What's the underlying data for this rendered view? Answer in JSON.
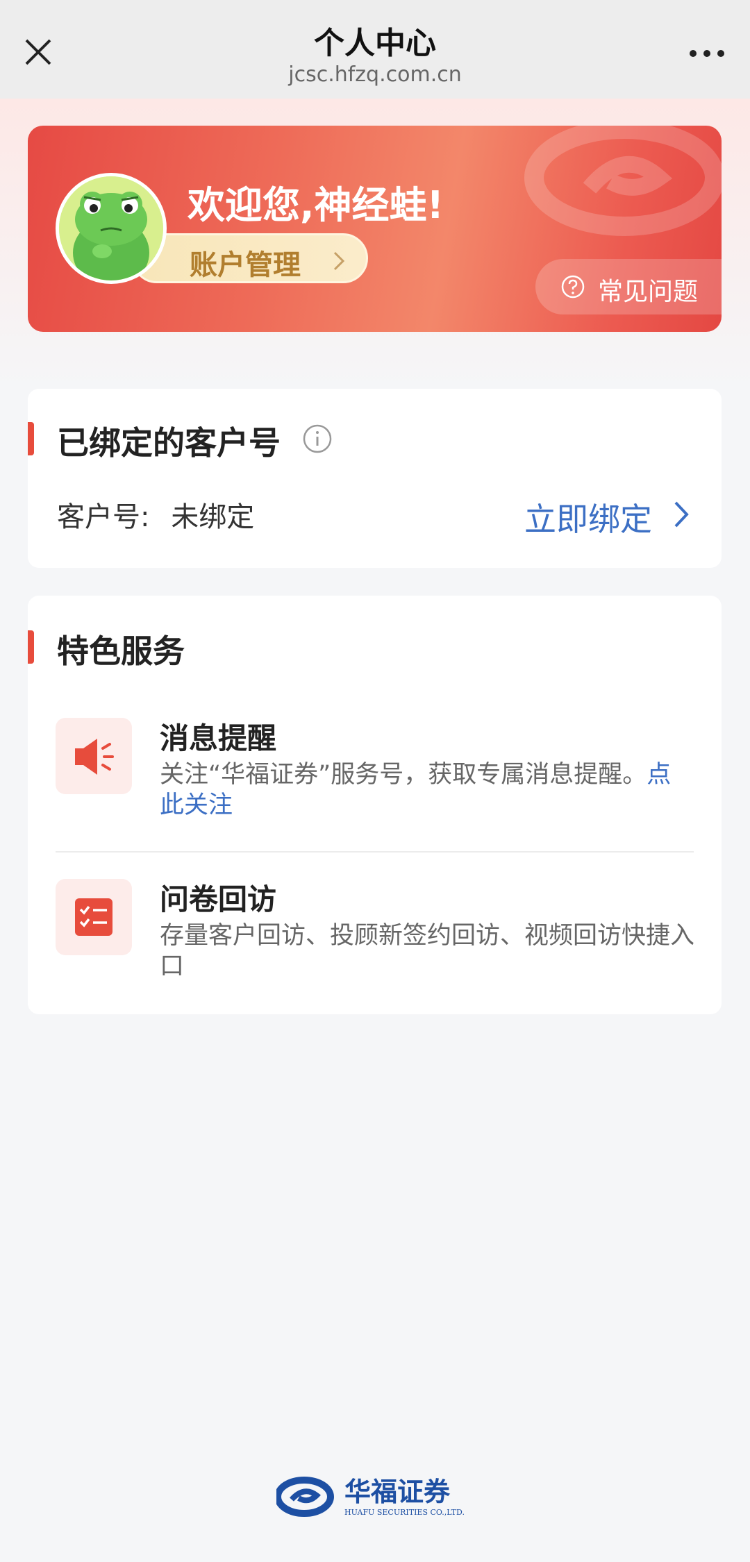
{
  "topbar": {
    "title": "个人中心",
    "url": "jcsc.hfzq.com.cn",
    "close_icon": "close-icon",
    "more_icon": "more-icon"
  },
  "banner": {
    "welcome": "欢迎您,神经蛙!",
    "account_button": "账户管理",
    "faq_button": "常见问题",
    "colors": {
      "start": "#e64a44",
      "mid": "#f3876a",
      "end": "#e44843"
    }
  },
  "bound_account": {
    "title": "已绑定的客户号",
    "customer_label": "客户号:",
    "customer_value": "未绑定",
    "bind_link": "立即绑定"
  },
  "services": {
    "title": "特色服务",
    "items": [
      {
        "title": "消息提醒",
        "desc": "关注“华福证券”服务号，获取专属消息提醒。",
        "link": "点此关注",
        "icon": "speaker-icon"
      },
      {
        "title": "问卷回访",
        "desc": "存量客户回访、投顾新签约回访、视频回访快捷入口",
        "link": "",
        "icon": "checklist-icon"
      }
    ]
  },
  "footer": {
    "brand": "华福证券",
    "brand_en": "HUAFU SECURITIES CO.,LTD."
  },
  "accent_color": "#e74c3c",
  "link_color": "#3c6fc4"
}
